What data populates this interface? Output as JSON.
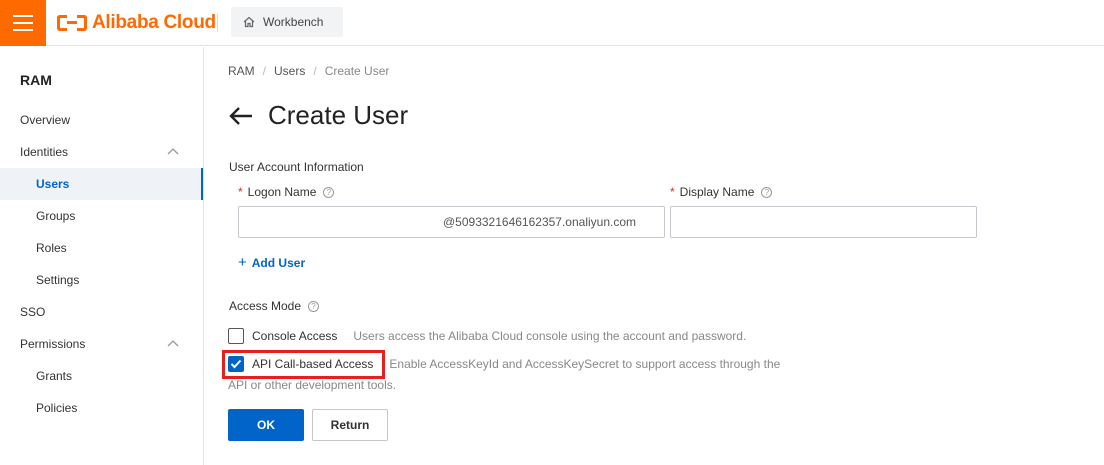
{
  "header": {
    "brand": "Alibaba Cloud",
    "workbench_label": "Workbench",
    "brand_color": "#ff6a00"
  },
  "sidebar": {
    "title": "RAM",
    "items": [
      {
        "label": "Overview",
        "level": 1
      },
      {
        "label": "Identities",
        "level": 1,
        "expanded": true
      },
      {
        "label": "Users",
        "level": 2,
        "active": true
      },
      {
        "label": "Groups",
        "level": 2
      },
      {
        "label": "Roles",
        "level": 2
      },
      {
        "label": "Settings",
        "level": 2
      },
      {
        "label": "SSO",
        "level": 1
      },
      {
        "label": "Permissions",
        "level": 1,
        "expanded": true
      },
      {
        "label": "Grants",
        "level": 2
      },
      {
        "label": "Policies",
        "level": 2
      }
    ]
  },
  "breadcrumb": {
    "items": [
      "RAM",
      "Users",
      "Create User"
    ],
    "separator": "/"
  },
  "page": {
    "title": "Create User"
  },
  "form": {
    "section_label": "User Account Information",
    "logon_name": {
      "label": "Logon Name",
      "required_mark": "*",
      "value": "",
      "suffix": "@5093321646162357.onaliyun.com"
    },
    "display_name": {
      "label": "Display Name",
      "required_mark": "*",
      "value": ""
    },
    "add_user_label": "Add User",
    "access_mode": {
      "label": "Access Mode",
      "options": [
        {
          "label": "Console Access",
          "description": "Users access the Alibaba Cloud console using the account and password.",
          "checked": false
        },
        {
          "label": "API Call-based Access",
          "description": "Enable AccessKeyId and AccessKeySecret to support access through the",
          "description_cont": "API or other development tools.",
          "checked": true
        }
      ]
    }
  },
  "actions": {
    "ok_label": "OK",
    "return_label": "Return"
  },
  "colors": {
    "primary": "#0064c8",
    "highlight": "#e81f1f"
  }
}
